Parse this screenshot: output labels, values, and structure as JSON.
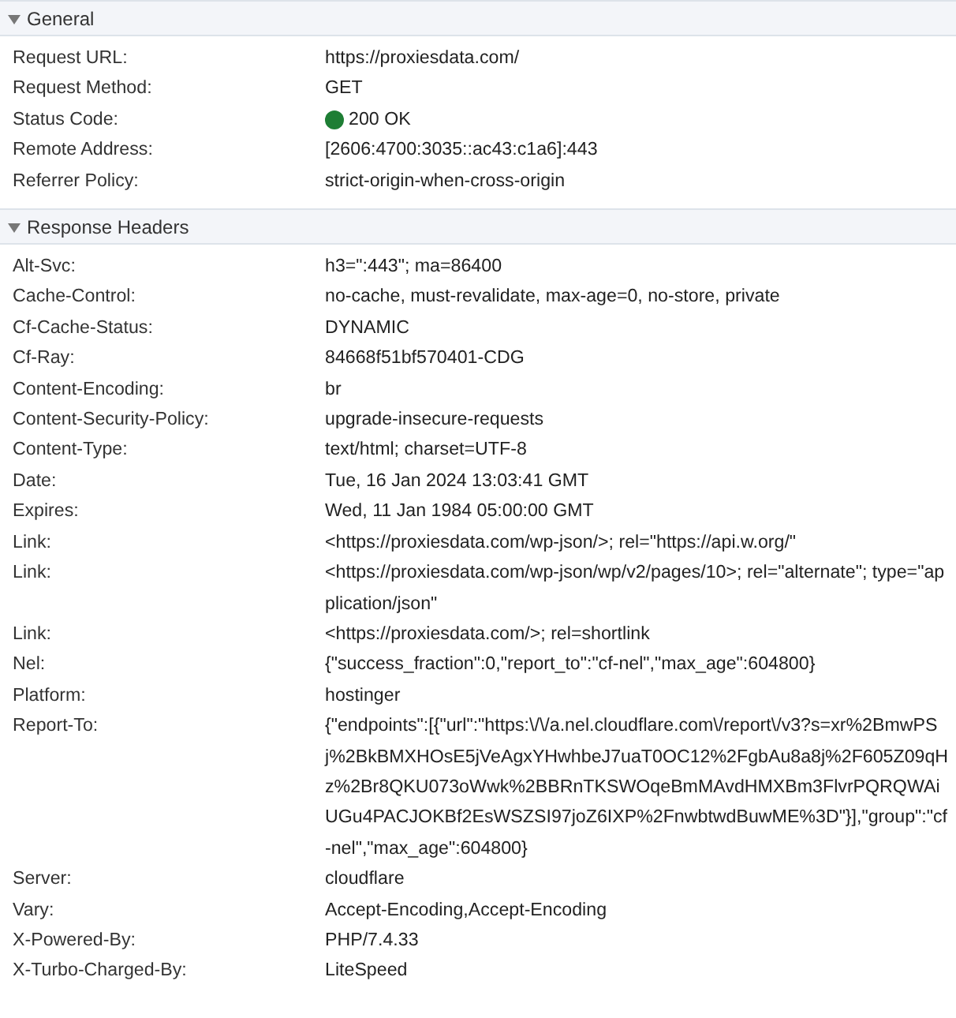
{
  "sections": [
    {
      "title": "General",
      "expanded": true,
      "rows": [
        {
          "name": "Request URL:",
          "value": "https://proxiesdata.com/"
        },
        {
          "name": "Request Method:",
          "value": "GET"
        },
        {
          "name": "Status Code:",
          "value": "200 OK",
          "color": "#1e7e34"
        },
        {
          "name": "Remote Address:",
          "value": "[2606:4700:3035::ac43:c1a6]:443"
        },
        {
          "name": "Referrer Policy:",
          "value": "strict-origin-when-cross-origin"
        }
      ]
    },
    {
      "title": "Response Headers",
      "expanded": true,
      "rows": [
        {
          "name": "Alt-Svc:",
          "value": "h3=\":443\"; ma=86400"
        },
        {
          "name": "Cache-Control:",
          "value": "no-cache, must-revalidate, max-age=0, no-store, private"
        },
        {
          "name": "Cf-Cache-Status:",
          "value": "DYNAMIC"
        },
        {
          "name": "Cf-Ray:",
          "value": "84668f51bf570401-CDG"
        },
        {
          "name": "Content-Encoding:",
          "value": "br"
        },
        {
          "name": "Content-Security-Policy:",
          "value": "upgrade-insecure-requests"
        },
        {
          "name": "Content-Type:",
          "value": "text/html; charset=UTF-8"
        },
        {
          "name": "Date:",
          "value": "Tue, 16 Jan 2024 13:03:41 GMT"
        },
        {
          "name": "Expires:",
          "value": "Wed, 11 Jan 1984 05:00:00 GMT"
        },
        {
          "name": "Link:",
          "value": "<https://proxiesdata.com/wp-json/>; rel=\"https://api.w.org/\""
        },
        {
          "name": "Link:",
          "value": "<https://proxiesdata.com/wp-json/wp/v2/pages/10>; rel=\"alternate\"; type=\"application/json\""
        },
        {
          "name": "Link:",
          "value": "<https://proxiesdata.com/>; rel=shortlink"
        },
        {
          "name": "Nel:",
          "value": "{\"success_fraction\":0,\"report_to\":\"cf-nel\",\"max_age\":604800}"
        },
        {
          "name": "Platform:",
          "value": "hostinger"
        },
        {
          "name": "Report-To:",
          "value": "{\"endpoints\":[{\"url\":\"https:\\/\\/a.nel.cloudflare.com\\/report\\/v3?s=xr%2BmwPSj%2BkBMXHOsE5jVeAgxYHwhbeJ7uaT0OC12%2FgbAu8a8j%2F605Z09qHz%2Br8QKU073oWwk%2BBRnTKSWOqeBmMAvdHMXBm3FlvrPQRQWAiUGu4PACJOKBf2EsWSZSI97joZ6IXP%2FnwbtwdBuwME%3D\"}],\"group\":\"cf-nel\",\"max_age\":604800}"
        },
        {
          "name": "Server:",
          "value": "cloudflare"
        },
        {
          "name": "Vary:",
          "value": "Accept-Encoding,Accept-Encoding"
        },
        {
          "name": "X-Powered-By:",
          "value": "PHP/7.4.33"
        },
        {
          "name": "X-Turbo-Charged-By:",
          "value": "LiteSpeed"
        }
      ]
    }
  ]
}
